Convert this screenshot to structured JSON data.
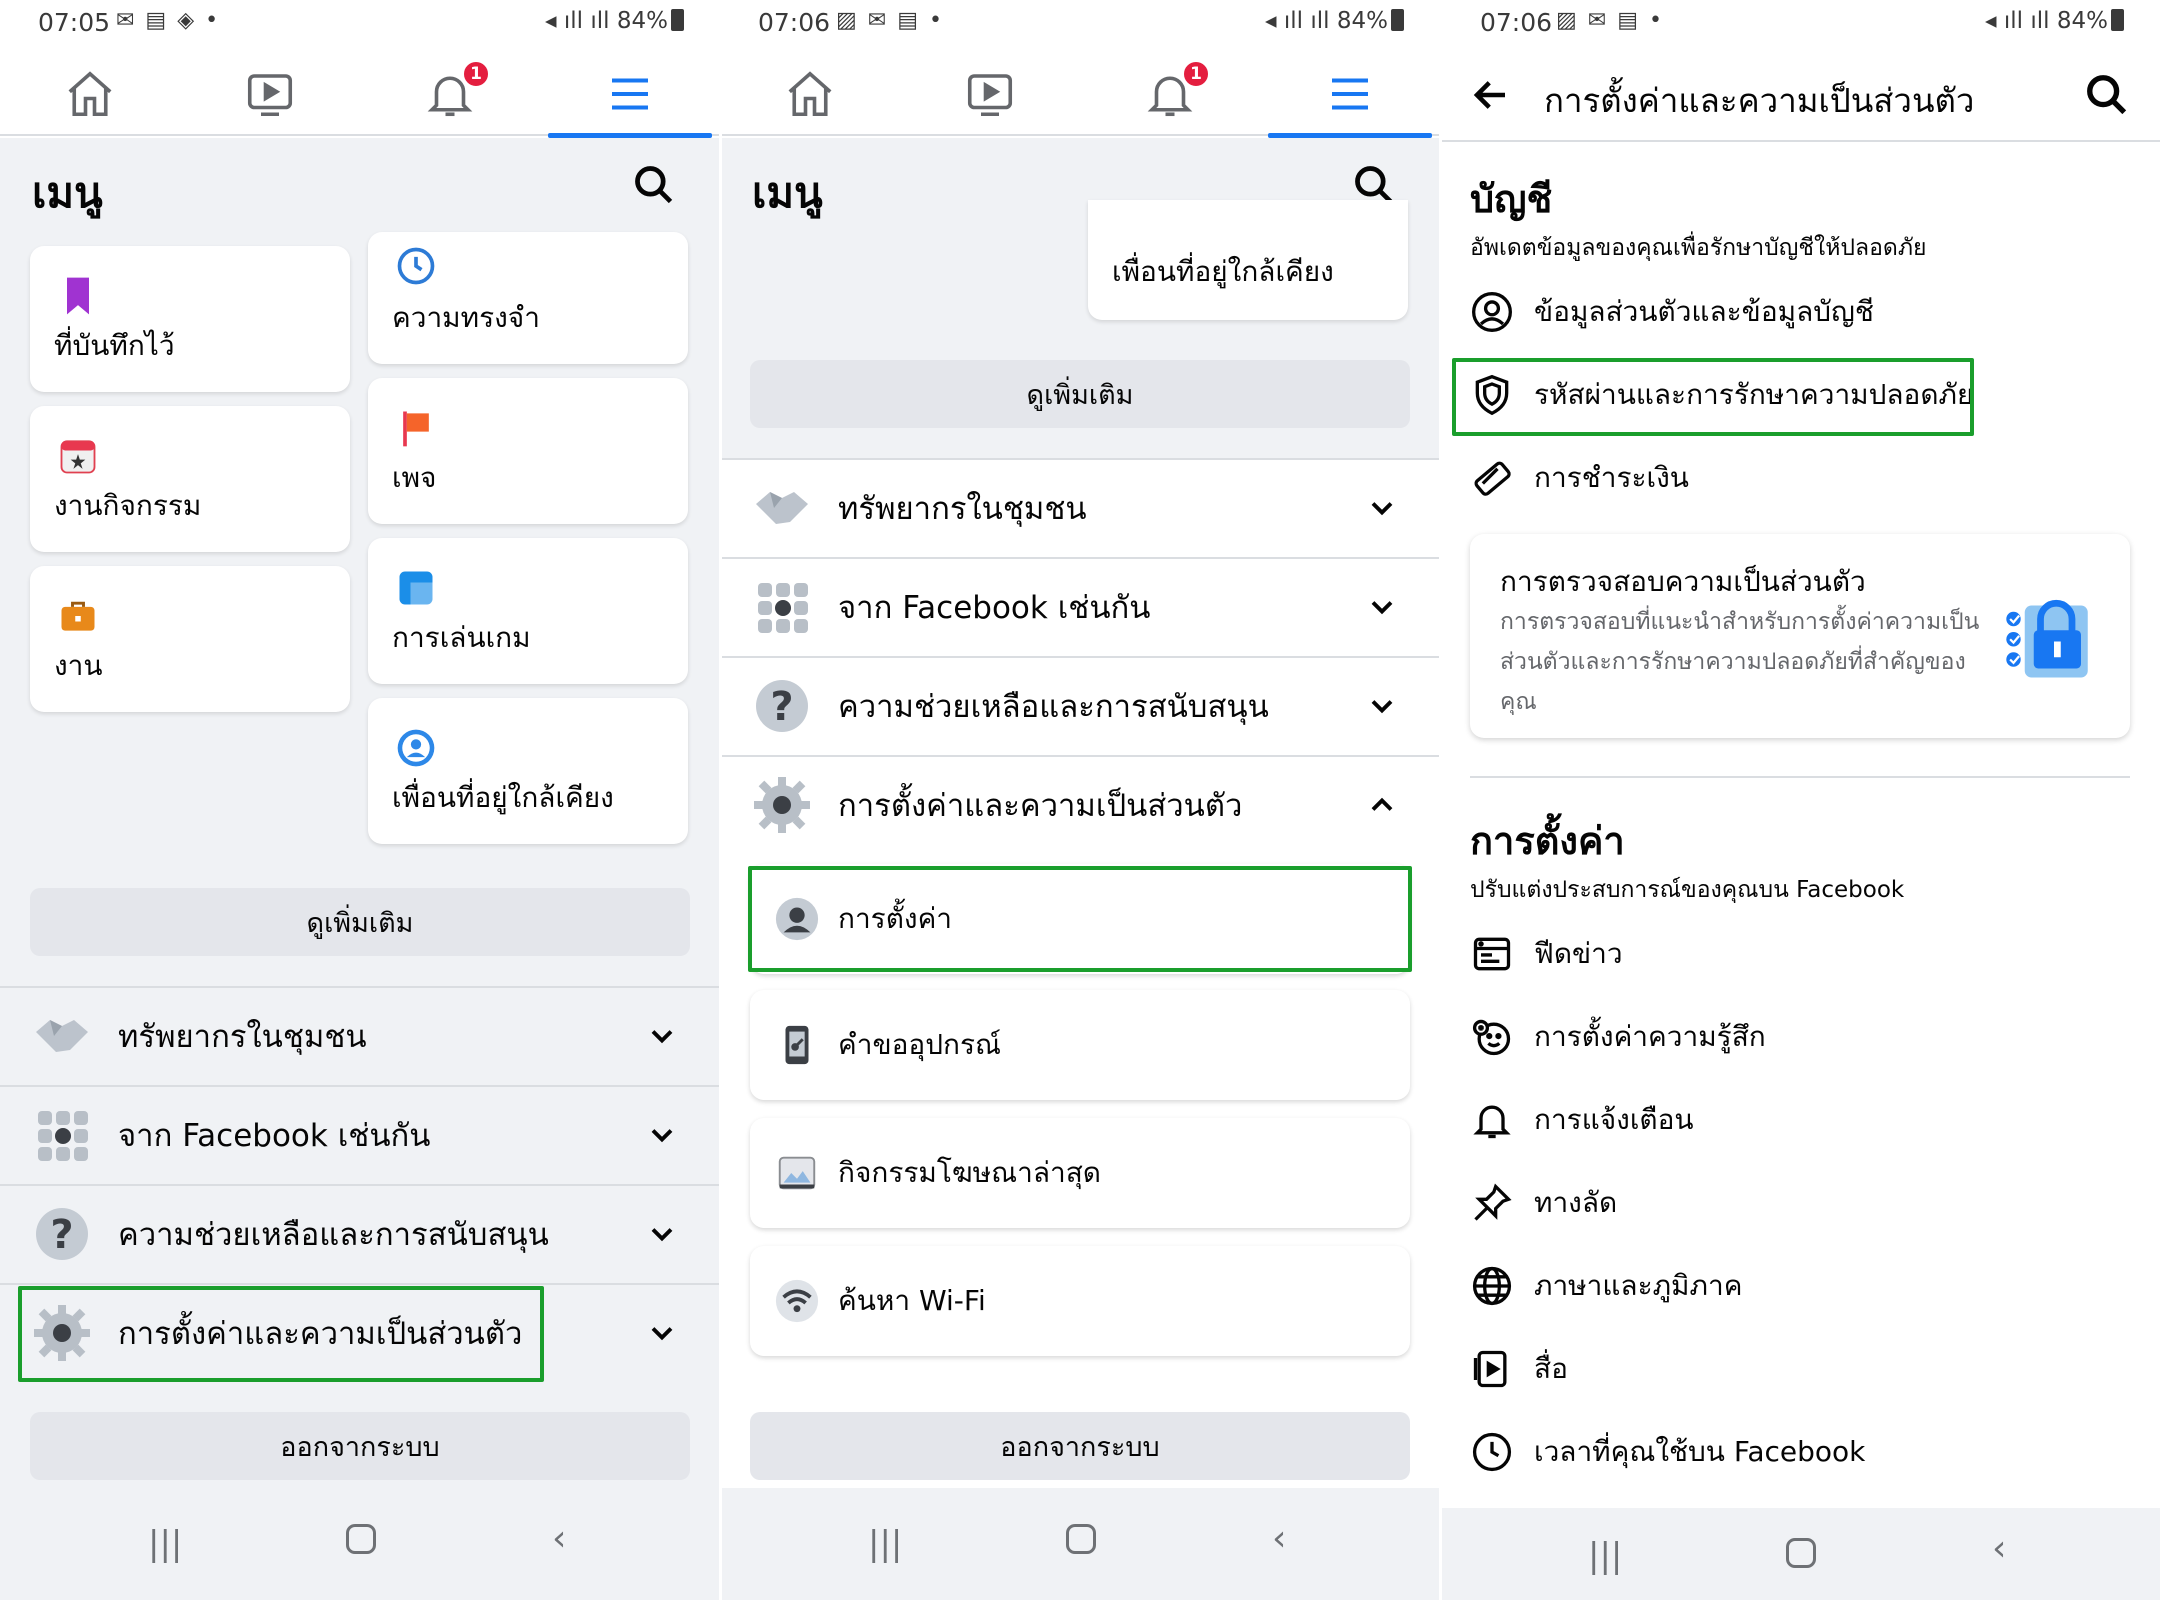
{
  "colors": {
    "accent": "#1877f2",
    "highlight": "#1a9e2c",
    "badge": "#e41e3f"
  },
  "panels": [
    {
      "status": {
        "time": "07:05",
        "battery": "84%"
      },
      "nav": {
        "notification_count": "1",
        "icons": [
          "home-icon",
          "watch-icon",
          "bell-icon",
          "menu-icon"
        ]
      },
      "menu_title": "เมนู",
      "shortcuts": {
        "saved": "ที่บันทึกไว้",
        "events": "งานกิจกรรม",
        "jobs": "งาน",
        "memories": "ความทรงจำ",
        "pages": "เพจ",
        "gaming": "การเล่นเกม",
        "nearby": "เพื่อนที่อยู่ใกล้เคียง"
      },
      "see_more": "ดูเพิ่มเติม",
      "sections": [
        {
          "label": "ทรัพยากรในชุมชน",
          "icon": "handshake-icon"
        },
        {
          "label": "จาก Facebook เช่นกัน",
          "icon": "grid-icon"
        },
        {
          "label": "ความช่วยเหลือและการสนับสนุน",
          "icon": "help-icon"
        },
        {
          "label": "การตั้งค่าและความเป็นส่วนตัว",
          "icon": "gear-icon"
        }
      ],
      "logout": "ออกจากระบบ"
    },
    {
      "status": {
        "time": "07:06",
        "battery": "84%"
      },
      "nav": {
        "notification_count": "1"
      },
      "menu_title": "เมนู",
      "nearby": "เพื่อนที่อยู่ใกล้เคียง",
      "see_more": "ดูเพิ่มเติม",
      "sections": [
        {
          "label": "ทรัพยากรในชุมชน"
        },
        {
          "label": "จาก Facebook เช่นกัน"
        },
        {
          "label": "ความช่วยเหลือและการสนับสนุน"
        },
        {
          "label": "การตั้งค่าและความเป็นส่วนตัว"
        }
      ],
      "sub_items": {
        "settings": "การตั้งค่า",
        "device_requests": "คำขออุปกรณ์",
        "ad_activity": "กิจกรรมโฆษณาล่าสุด",
        "wifi": "ค้นหา Wi-Fi"
      },
      "logout": "ออกจากระบบ"
    },
    {
      "status": {
        "time": "07:06",
        "battery": "84%"
      },
      "title": "การตั้งค่าและความเป็นส่วนตัว",
      "account": {
        "heading": "บัญชี",
        "desc": "อัพเดตข้อมูลของคุณเพื่อรักษาบัญชีให้ปลอดภัย",
        "items": {
          "personal": "ข้อมูลส่วนตัวและข้อมูลบัญชี",
          "password": "รหัสผ่านและการรักษาความปลอดภัย",
          "payments": "การชำระเงิน"
        }
      },
      "privacy_checkup": {
        "title": "การตรวจสอบความเป็นส่วนตัว",
        "desc": "การตรวจสอบที่แนะนำสำหรับการตั้งค่าความเป็นส่วนตัวและการรักษาความปลอดภัยที่สำคัญของคุณ"
      },
      "settings": {
        "heading": "การตั้งค่า",
        "desc": "ปรับแต่งประสบการณ์ของคุณบน Facebook",
        "items": {
          "feed": "ฟีดข่าว",
          "reactions": "การตั้งค่าความรู้สึก",
          "notifications": "การแจ้งเตือน",
          "shortcuts": "ทางลัด",
          "language": "ภาษาและภูมิภาค",
          "media": "สื่อ",
          "time": "เวลาที่คุณใช้บน Facebook"
        }
      }
    }
  ]
}
